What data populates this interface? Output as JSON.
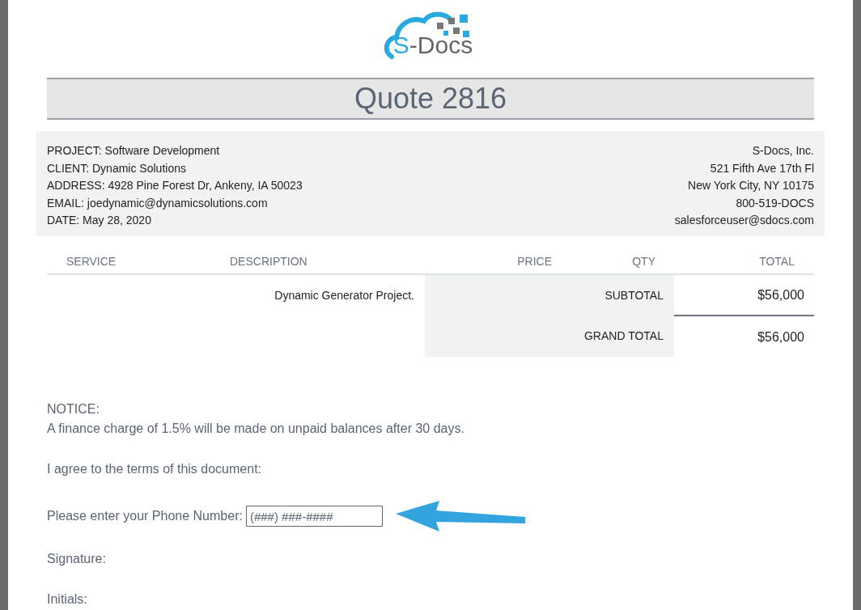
{
  "logo": {
    "mark": "S",
    "text": "-Docs"
  },
  "title": "Quote 2816",
  "client_info": [
    "PROJECT: Software Development",
    "CLIENT: Dynamic Solutions",
    "ADDRESS: 4928 Pine Forest Dr, Ankeny, IA 50023",
    "EMAIL: joedynamic@dynamicsolutions.com",
    "DATE: May 28, 2020"
  ],
  "company_info": [
    "S-Docs, Inc.",
    "521 Fifth Ave 17th Fl",
    "New York City, NY 10175",
    "800-519-DOCS",
    "salesforceuser@sdocs.com"
  ],
  "table": {
    "columns": [
      "SERVICE",
      "DESCRIPTION",
      "PRICE",
      "QTY",
      "TOTAL"
    ],
    "description": "Dynamic Generator Project.",
    "totals": [
      {
        "label": "SUBTOTAL",
        "value": "$56,000"
      },
      {
        "label": "GRAND TOTAL",
        "value": "$56,000"
      }
    ]
  },
  "notice": {
    "heading": "NOTICE:",
    "text": "A finance charge of 1.5% will be made on unpaid balances after 30 days."
  },
  "agree": "I agree to the terms of this document:",
  "phone": {
    "label": "Please enter your Phone Number:",
    "placeholder": "(###) ###-####"
  },
  "signature": "Signature:",
  "initials": "Initials:"
}
